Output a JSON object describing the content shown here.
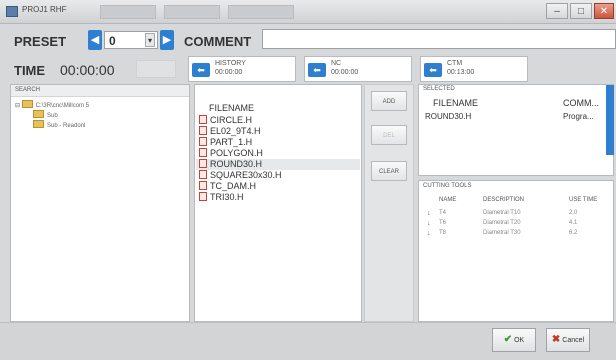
{
  "window": {
    "title": "PROJ1 RHF"
  },
  "faded_tabs": [
    "",
    "",
    ""
  ],
  "preset": {
    "label": "PRESET",
    "value": "0",
    "dropdown_arrow": "▾"
  },
  "comment": {
    "label": "COMMENT",
    "value": ""
  },
  "time": {
    "label": "TIME",
    "value": "00:00:00"
  },
  "history": {
    "label": "HISTORY",
    "time": "00:00:00"
  },
  "nc": {
    "label": "NC",
    "time": "00:00:00"
  },
  "ctm": {
    "label": "CTM",
    "time": "00:13:00"
  },
  "search": {
    "label": "SEARCH",
    "tree": [
      {
        "text": "C:\\3R\\cnc\\Millcom 5",
        "level": 0
      },
      {
        "text": "Sub",
        "level": 1
      },
      {
        "text": "Sub - Readonl",
        "level": 1
      }
    ]
  },
  "files": {
    "header": "FILENAME",
    "items": [
      "CIRCLE.H",
      "EL02_9T4.H",
      "PART_1.H",
      "POLYGON.H",
      "ROUND30.H",
      "SQUARE30x30.H",
      "TC_DAM.H",
      "TRI30.H"
    ],
    "selected_index": 4
  },
  "buttons": {
    "add": "ADD",
    "del": "DEL",
    "clear": "CLEAR",
    "ok": "OK",
    "cancel": "Cancel"
  },
  "selected": {
    "label": "SELECTED",
    "headers": [
      "FILENAME",
      "COMM..."
    ],
    "rows": [
      {
        "filename": "ROUND30.H",
        "comment": "Progra..."
      }
    ]
  },
  "cutting_tools": {
    "label": "CUTTING TOOLS",
    "headers": [
      "NAME",
      "DESCRIPTION",
      "USE TIME"
    ],
    "rows": [
      {
        "name": "T4",
        "desc": "Diametral T10",
        "use": "2.0"
      },
      {
        "name": "T6",
        "desc": "Diametral T20",
        "use": "4.1"
      },
      {
        "name": "T8",
        "desc": "Diametral T30",
        "use": "6.2"
      }
    ]
  },
  "icons": {
    "prev": "arrow-left-icon",
    "next": "arrow-right-icon",
    "ok": "check-icon",
    "cancel": "x-icon"
  },
  "colors": {
    "accent": "#2e7fd0",
    "ok_check": "#3a9a2a",
    "cancel_x": "#c0392b"
  }
}
